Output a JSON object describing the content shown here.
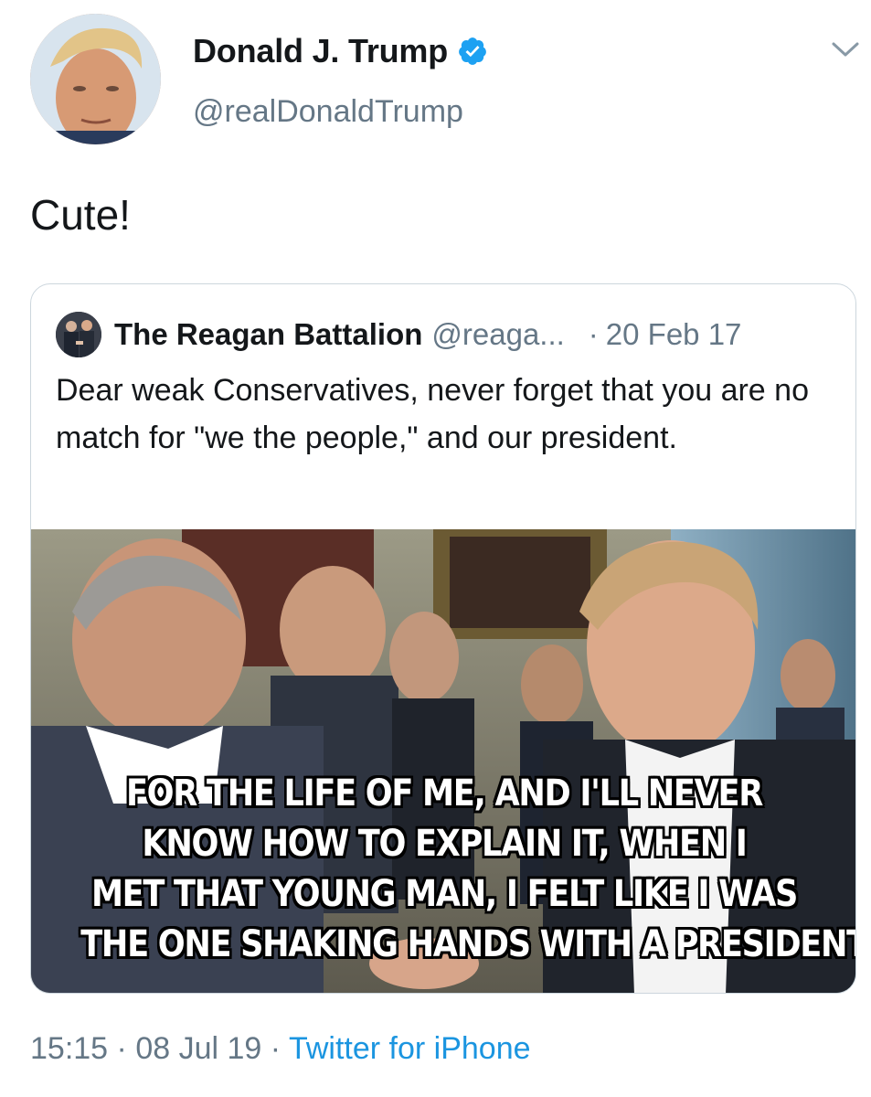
{
  "author": {
    "display_name": "Donald J. Trump",
    "handle": "@realDonaldTrump",
    "verified_icon": "verified-badge-icon",
    "menu_icon": "chevron-down-icon"
  },
  "tweet": {
    "text": "Cute!"
  },
  "quoted_tweet": {
    "author_name": "The Reagan Battalion",
    "author_handle": "@reaga...",
    "separator": "·",
    "date": "20 Feb 17",
    "text": "Dear weak Conservatives, never forget that you are no match for \"we the people,\" and our president.",
    "image_caption_lines": [
      "FOR THE LIFE OF ME, AND I'LL NEVER",
      "KNOW HOW TO EXPLAIN IT, WHEN I",
      "MET THAT YOUNG MAN, I FELT LIKE I WAS",
      "THE ONE SHAKING HANDS WITH A PRESIDENT."
    ]
  },
  "footer": {
    "time": "15:15",
    "sep1": "·",
    "date": "08 Jul 19",
    "sep2": "·",
    "source": "Twitter for iPhone"
  },
  "colors": {
    "text_primary": "#14171a",
    "text_secondary": "#657786",
    "link": "#1b95e0",
    "verified": "#1da1f2",
    "border": "#ccd6dd"
  }
}
